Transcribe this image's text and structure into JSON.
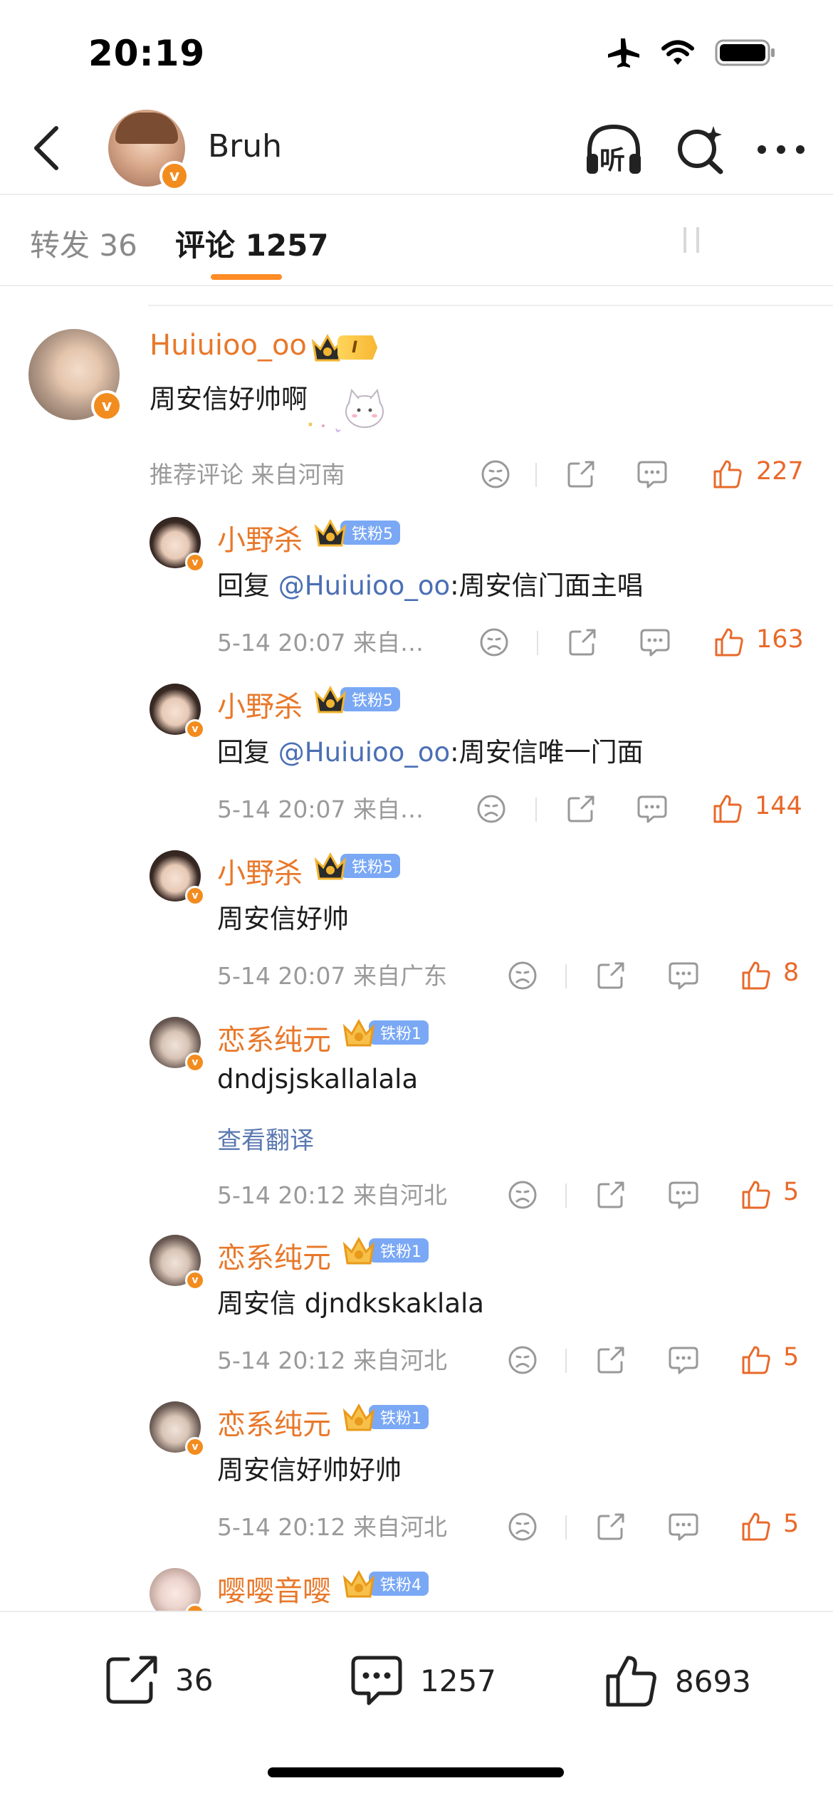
{
  "status_bar": {
    "time": "20:19"
  },
  "header": {
    "username": "Bruh",
    "listen_label": "听"
  },
  "tabs": {
    "repost": "转发 36",
    "comment": "评论 1257"
  },
  "comments": [
    {
      "name": "Huiuioo_oo",
      "badge_level": "I",
      "text": "周安信好帅啊",
      "meta": "推荐评论  来自河南",
      "likes": "227"
    },
    {
      "name": "小野杀",
      "badge": "铁粉5",
      "reply_prefix": "回复 ",
      "mention": "@Huiuioo_oo",
      "text": ":周安信门面主唱",
      "meta": "5-14 20:07  来自…",
      "likes": "163"
    },
    {
      "name": "小野杀",
      "badge": "铁粉5",
      "reply_prefix": "回复 ",
      "mention": "@Huiuioo_oo",
      "text": ":周安信唯一门面",
      "meta": "5-14 20:07  来自…",
      "likes": "144"
    },
    {
      "name": "小野杀",
      "badge": "铁粉5",
      "text": "周安信好帅",
      "meta": "5-14 20:07  来自广东",
      "likes": "8"
    },
    {
      "name": "恋系纯元",
      "badge": "铁粉1",
      "text": "dndjsjskallalala",
      "translate": "查看翻译",
      "meta": "5-14 20:12  来自河北",
      "likes": "5"
    },
    {
      "name": "恋系纯元",
      "badge": "铁粉1",
      "text": "周安信 djndkskaklala",
      "meta": "5-14 20:12  来自河北",
      "likes": "5"
    },
    {
      "name": "恋系纯元",
      "badge": "铁粉1",
      "text": "周安信好帅好帅",
      "meta": "5-14 20:12  来自河北",
      "likes": "5"
    },
    {
      "name": "嘤嘤音嘤",
      "badge": "铁粉4"
    }
  ],
  "bottom_bar": {
    "repost_count": "36",
    "comment_count": "1257",
    "like_count": "8693"
  },
  "colors": {
    "accent_orange": "#e8782a",
    "like_orange": "#e8692a",
    "mention_blue": "#4a6fb4",
    "tab_underline": "#ff8c25"
  }
}
